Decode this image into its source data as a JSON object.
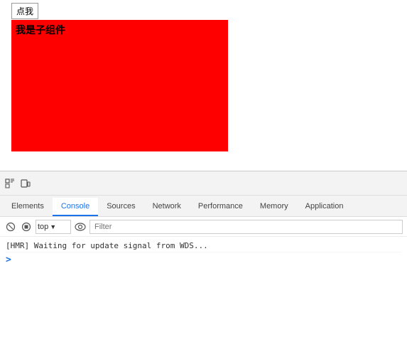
{
  "app": {
    "button_label": "点我",
    "child_label": "我是子组件"
  },
  "devtools": {
    "toolbar_icons": [
      "cursor",
      "device"
    ],
    "tabs": [
      {
        "label": "Elements",
        "active": false
      },
      {
        "label": "Console",
        "active": true
      },
      {
        "label": "Sources",
        "active": false
      },
      {
        "label": "Network",
        "active": false
      },
      {
        "label": "Performance",
        "active": false
      },
      {
        "label": "Memory",
        "active": false
      },
      {
        "label": "Application",
        "active": false
      }
    ],
    "console": {
      "context": "top",
      "filter_placeholder": "Filter",
      "log_line": "[HMR] Waiting for update signal from WDS...",
      "prompt": ">"
    }
  }
}
